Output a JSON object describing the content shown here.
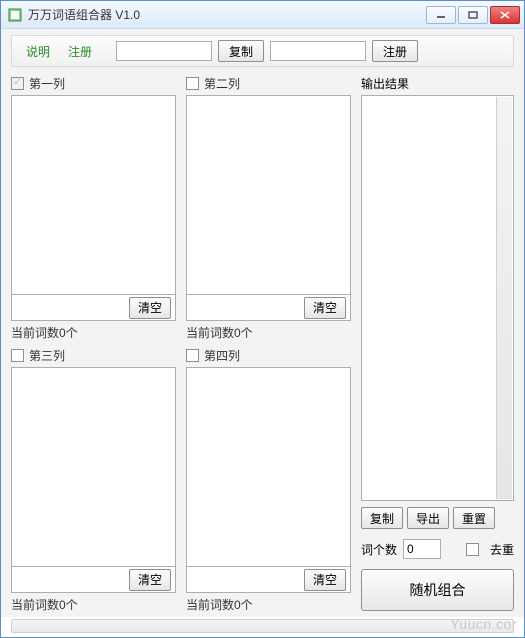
{
  "window": {
    "title": "万万词语组合器 V1.0"
  },
  "toolbar": {
    "help_label": "说明",
    "register_link_label": "注册",
    "input1_value": "",
    "copy_label": "复制",
    "input2_value": "",
    "register_button_label": "注册"
  },
  "columns": {
    "col1": {
      "label": "第一列",
      "checked": true,
      "disabled": true,
      "clear_label": "清空",
      "count_label": "当前词数0个"
    },
    "col2": {
      "label": "第二列",
      "checked": false,
      "disabled": false,
      "clear_label": "清空",
      "count_label": "当前词数0个"
    },
    "col3": {
      "label": "第三列",
      "checked": false,
      "disabled": false,
      "clear_label": "清空",
      "count_label": "当前词数0个"
    },
    "col4": {
      "label": "第四列",
      "checked": false,
      "disabled": false,
      "clear_label": "清空",
      "count_label": "当前词数0个"
    }
  },
  "output": {
    "label": "输出结果",
    "copy_label": "复制",
    "export_label": "导出",
    "reset_label": "重置",
    "word_count_label": "词个数",
    "word_count_value": "0",
    "dedup_label": "去重",
    "dedup_checked": false,
    "combine_label": "随机组合"
  },
  "watermark": "Yuucn.cor"
}
